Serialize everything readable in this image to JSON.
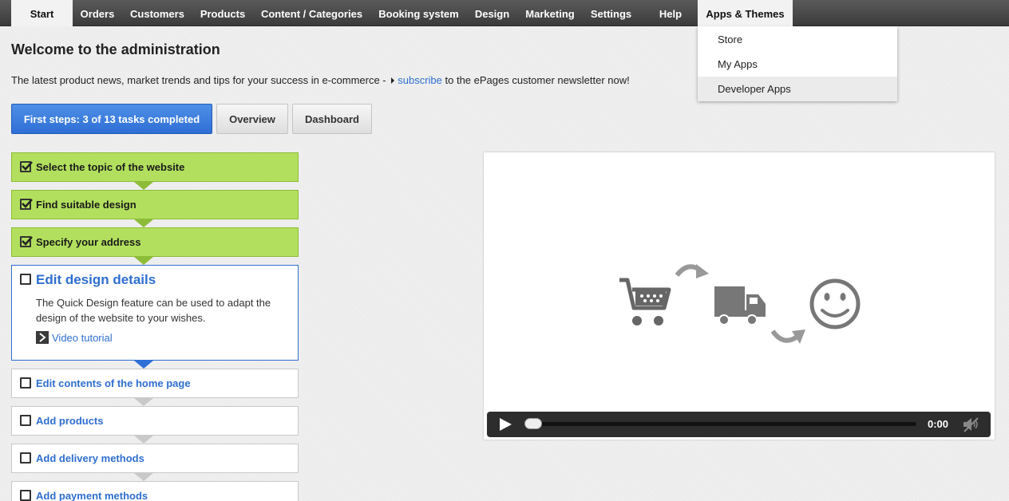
{
  "nav": {
    "items": [
      {
        "label": "Start",
        "active": true
      },
      {
        "label": "Orders"
      },
      {
        "label": "Customers"
      },
      {
        "label": "Products"
      },
      {
        "label": "Content / Categories"
      },
      {
        "label": "Booking system"
      },
      {
        "label": "Design"
      },
      {
        "label": "Marketing"
      },
      {
        "label": "Settings"
      },
      {
        "label": "Help"
      },
      {
        "label": "Apps & Themes",
        "active": true
      }
    ]
  },
  "dropdown": {
    "items": [
      {
        "label": "Store"
      },
      {
        "label": "My Apps"
      },
      {
        "label": "Developer Apps",
        "hovered": true
      }
    ]
  },
  "page": {
    "title": "Welcome to the administration",
    "intro_before": "The latest product news, market trends and tips for your success in e-commerce - ",
    "intro_link": "subscribe",
    "intro_after": " to the ePages customer newsletter now!"
  },
  "tabs": {
    "first_steps": "First steps: 3 of 13 tasks completed",
    "overview": "Overview",
    "dashboard": "Dashboard"
  },
  "steps": [
    {
      "label": "Select the topic of the website",
      "checked": true
    },
    {
      "label": "Find suitable design",
      "checked": true
    },
    {
      "label": "Specify your address",
      "checked": true
    },
    {
      "label": "Edit design details",
      "checked": false,
      "description": "The Quick Design feature can be used to adapt the design of the website to your wishes.",
      "link": "Video tutorial"
    },
    {
      "label": "Edit contents of the home page",
      "checked": false
    },
    {
      "label": "Add products",
      "checked": false
    },
    {
      "label": "Add delivery methods",
      "checked": false
    },
    {
      "label": "Add payment methods",
      "checked": false
    }
  ],
  "video": {
    "time": "0:00",
    "progress": 0,
    "icons": [
      "shopping-cart-icon",
      "arrow-icon",
      "delivery-truck-icon",
      "arrow-icon",
      "smiley-icon"
    ]
  },
  "colors": {
    "accent": "#2f6fd6",
    "done": "#b2e05e",
    "link": "#2f6ecf",
    "nav_bg": "#444444"
  }
}
